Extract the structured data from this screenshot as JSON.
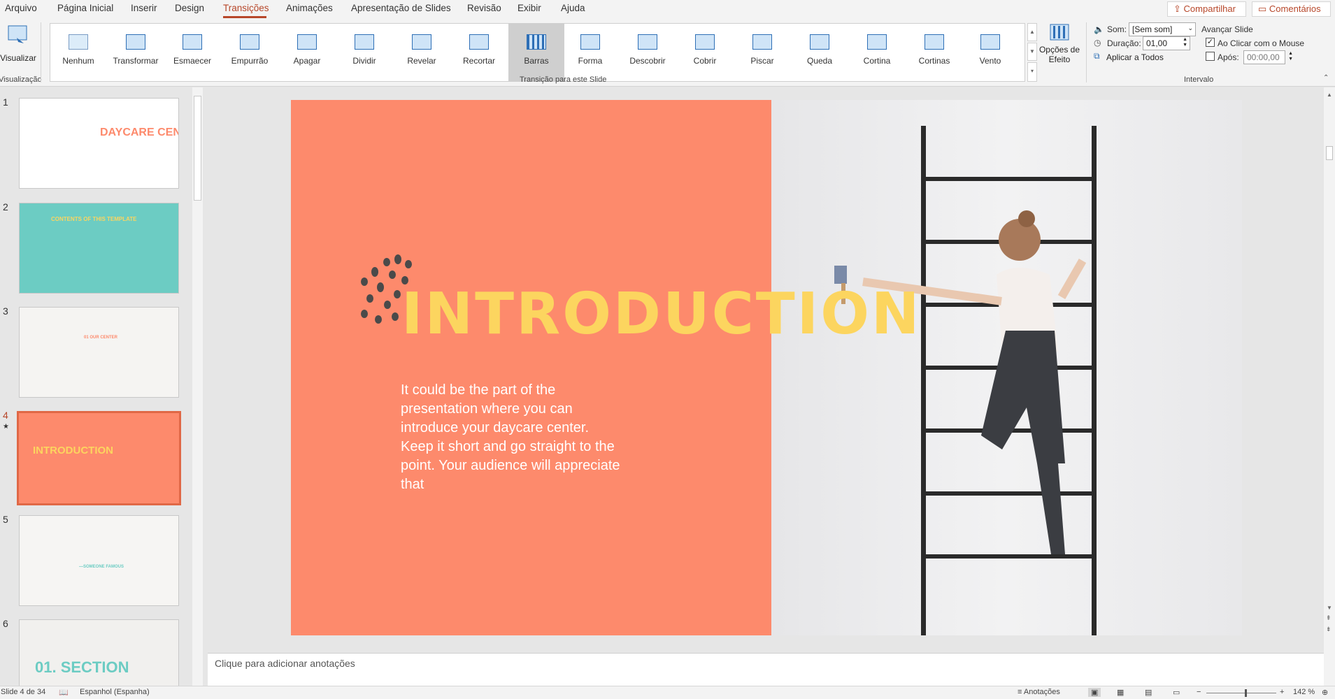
{
  "app": {
    "menu_tabs": [
      "Arquivo",
      "Página Inicial",
      "Inserir",
      "Design",
      "Transições",
      "Animações",
      "Apresentação de Slides",
      "Revisão",
      "Exibir",
      "Ajuda"
    ],
    "share_label": "Compartilhar",
    "comments_label": "Comentários",
    "accent_color": "#b7472a"
  },
  "ribbon": {
    "preview_label": "Visualizar",
    "preview_group_label": "Visualização",
    "transitions": [
      {
        "label": "Nenhum"
      },
      {
        "label": "Transformar"
      },
      {
        "label": "Esmaecer"
      },
      {
        "label": "Empurrão"
      },
      {
        "label": "Apagar"
      },
      {
        "label": "Dividir"
      },
      {
        "label": "Revelar"
      },
      {
        "label": "Recortar"
      },
      {
        "label": "Barras",
        "selected": true
      },
      {
        "label": "Forma"
      },
      {
        "label": "Descobrir"
      },
      {
        "label": "Cobrir"
      },
      {
        "label": "Piscar"
      },
      {
        "label": "Queda"
      },
      {
        "label": "Cortina"
      },
      {
        "label": "Cortinas"
      },
      {
        "label": "Vento"
      }
    ],
    "gallery_group_label": "Transição para este Slide",
    "effect_options_label_1": "Opções de",
    "effect_options_label_2": "Efeito",
    "sound_label": "Som:",
    "sound_value": "[Sem som]",
    "duration_label": "Duração:",
    "duration_value": "01,00",
    "apply_all_label": "Aplicar a Todos",
    "advance_label": "Avançar Slide",
    "on_click_label": "Ao Clicar com o Mouse",
    "on_click_checked": true,
    "after_label": "Após:",
    "after_checked": false,
    "after_value": "00:00,00",
    "timing_group_label": "Intervalo"
  },
  "thumbnails": [
    {
      "num": "1",
      "bg": "#ffffff",
      "text": "DAYCARE CENTER"
    },
    {
      "num": "2",
      "bg": "#6cccc3",
      "text": "CONTENTS OF THIS TEMPLATE"
    },
    {
      "num": "3",
      "bg": "#f5f4f2",
      "text": "01 OUR CENTER"
    },
    {
      "num": "4",
      "bg": "#fd8a6c",
      "text": "INTRODUCTION",
      "star": "★",
      "selected": true
    },
    {
      "num": "5",
      "bg": "#f6f5f3",
      "text": "—SOMEONE FAMOUS"
    },
    {
      "num": "6",
      "bg": "#f1f0ee",
      "text": "01. SECTION"
    }
  ],
  "slide": {
    "title": "INTRODUCTION",
    "body": "It could be the part of the presentation where you can introduce your daycare center. Keep it short and go straight to the point. Your audience will appreciate that",
    "orange_color": "#fd8a6c",
    "title_color": "#fcd55f"
  },
  "notes_placeholder": "Clique para adicionar anotações",
  "status": {
    "slide_count": "Slide 4 de 34",
    "language": "Espanhol (Espanha)",
    "notes_button": "Anotações",
    "zoom": "142 %"
  }
}
